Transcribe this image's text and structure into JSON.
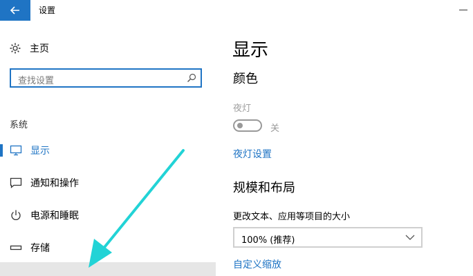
{
  "window": {
    "title": "设置"
  },
  "sidebar": {
    "home": "主页",
    "search_placeholder": "查找设置",
    "section": "系统",
    "items": [
      {
        "label": "显示",
        "icon": "monitor-icon",
        "active": true
      },
      {
        "label": "通知和操作",
        "icon": "notification-icon"
      },
      {
        "label": "电源和睡眠",
        "icon": "power-icon"
      },
      {
        "label": "存储",
        "icon": "storage-icon"
      }
    ]
  },
  "main": {
    "title": "显示",
    "color": {
      "heading": "颜色",
      "night_light_label": "夜灯",
      "toggle_state": "关",
      "night_light_settings": "夜灯设置"
    },
    "scale": {
      "heading": "规模和布局",
      "caption": "更改文本、应用等项目的大小",
      "dropdown_value": "100% (推荐)",
      "custom_scaling": "自定义缩放"
    }
  },
  "colors": {
    "accent": "#1f74c4",
    "annotation_arrow": "#22d3d6"
  }
}
